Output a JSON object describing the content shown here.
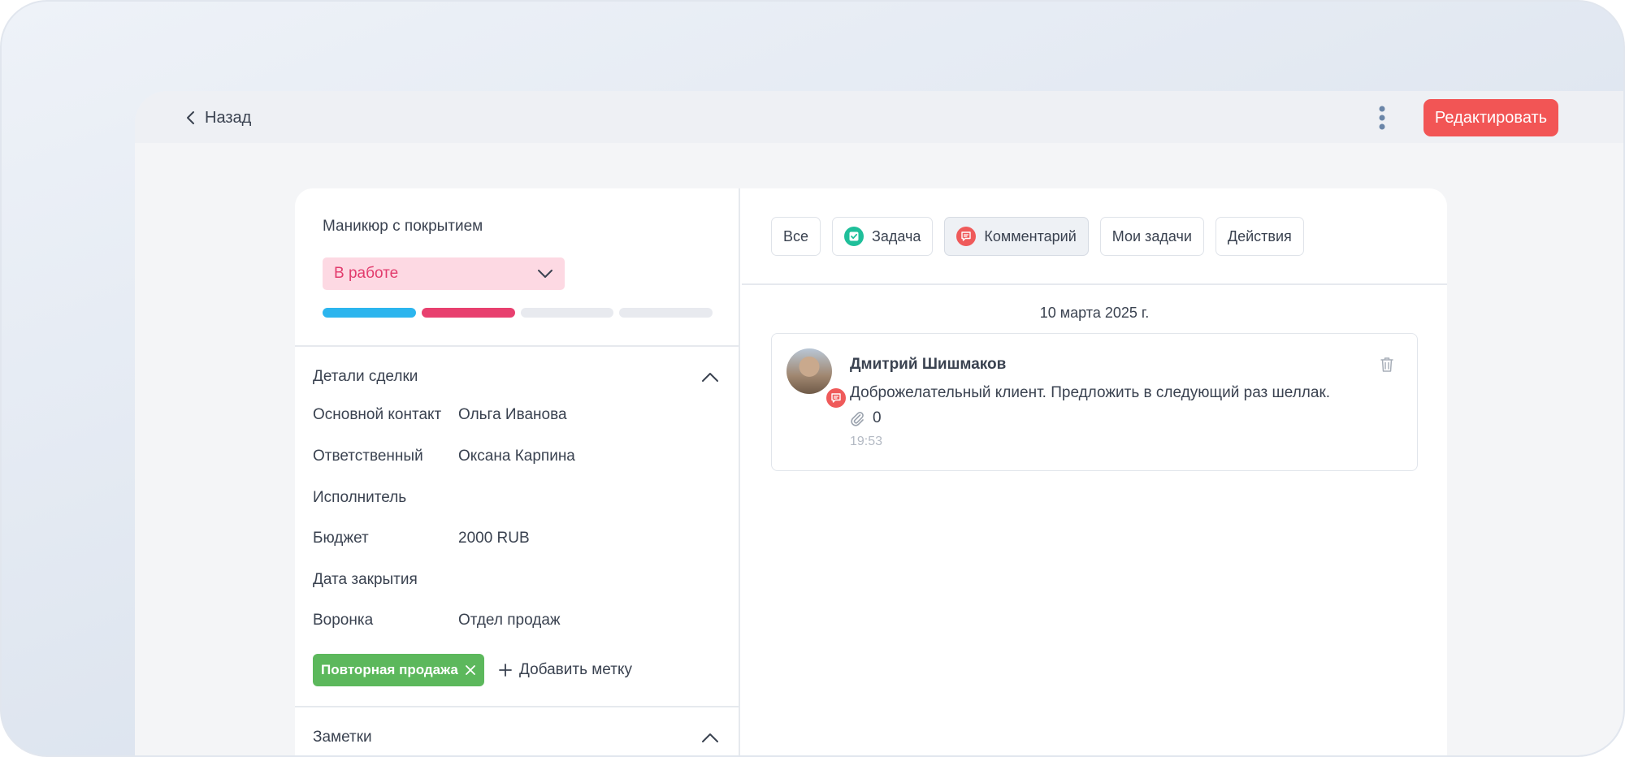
{
  "header": {
    "back_label": "Назад",
    "edit_label": "Редактировать"
  },
  "deal": {
    "title": "Маникюр с покрытием",
    "status": "В работе",
    "stages_total": 4,
    "stages_completed": 2,
    "colors": {
      "stage1": "#2cb5ee",
      "stage2": "#e8406f",
      "accent": "#f25555",
      "tag": "#5cb85c"
    }
  },
  "details": {
    "section_title": "Детали сделки",
    "rows": [
      {
        "label": "Основной контакт",
        "value": "Ольга Иванова"
      },
      {
        "label": "Ответственный",
        "value": "Оксана Карпина"
      },
      {
        "label": "Исполнитель",
        "value": ""
      },
      {
        "label": "Бюджет",
        "value": "2000 RUB"
      },
      {
        "label": "Дата закрытия",
        "value": ""
      },
      {
        "label": "Воронка",
        "value": "Отдел продаж"
      }
    ],
    "tags": [
      "Повторная продажа"
    ],
    "add_tag_label": "Добавить метку"
  },
  "notes": {
    "section_title": "Заметки"
  },
  "feed": {
    "filters": [
      {
        "label": "Все"
      },
      {
        "label": "Задача",
        "icon": "task-check-icon"
      },
      {
        "label": "Комментарий",
        "icon": "comment-icon",
        "active": true
      },
      {
        "label": "Мои задачи"
      },
      {
        "label": "Действия"
      }
    ],
    "date": "10 марта 2025 г.",
    "comment": {
      "author": "Дмитрий Шишмаков",
      "text": "Доброжелательный клиент. Предложить в следующий раз шеллак.",
      "attachments": "0",
      "time": "19:53"
    }
  }
}
